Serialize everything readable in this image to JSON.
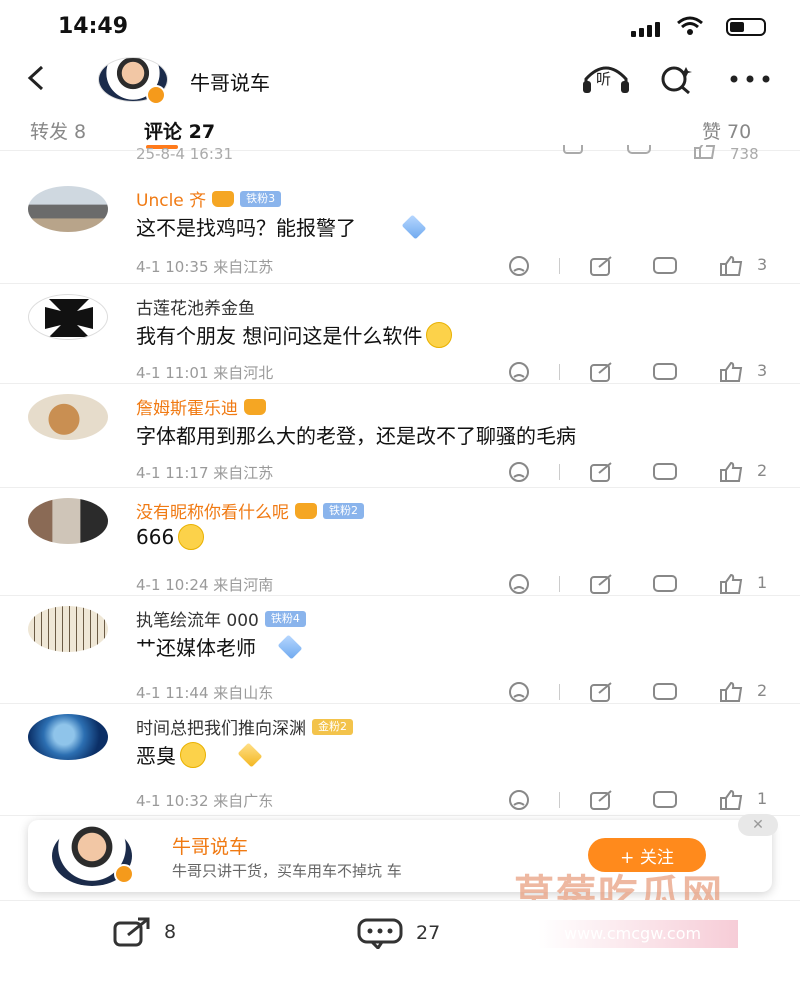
{
  "status_bar": {
    "time": "14:49"
  },
  "header": {
    "title": "牛哥说车",
    "listen_label": "听"
  },
  "tabs": {
    "repost": "转发 8",
    "comments": "评论 27",
    "likes": "赞 70"
  },
  "previous_row": {
    "meta": "25-8-4 16:31",
    "likes": "738"
  },
  "comments": [
    {
      "name": "Uncle 齐",
      "badge": "铁粉3",
      "text": "这不是找鸡吗？能报警了",
      "meta": "4-1 10:35  来自江苏",
      "likes": "3"
    },
    {
      "name": "古莲花池养金鱼",
      "badge": "",
      "text": "我有个朋友  想问问这是什么软件",
      "meta": "4-1 11:01  来自河北",
      "likes": "3"
    },
    {
      "name": "詹姆斯霍乐迪",
      "badge": "",
      "text": "字体都用到那么大的老登，还是改不了聊骚的毛病",
      "meta": "4-1 11:17  来自江苏",
      "likes": "2"
    },
    {
      "name": "没有昵称你看什么呢",
      "badge": "铁粉2",
      "text": "666",
      "meta": "4-1 10:24  来自河南",
      "likes": "1"
    },
    {
      "name": "执笔绘流年 000",
      "badge": "铁粉4",
      "text": "艹还媒体老师",
      "meta": "4-1 11:44  来自山东",
      "likes": "2"
    },
    {
      "name": "时间总把我们推向深渊",
      "badge": "金粉2",
      "text": "恶臭",
      "meta": "4-1 10:32  来自广东",
      "likes": "1"
    }
  ],
  "follow_banner": {
    "name": "牛哥说车",
    "subtitle": "牛哥只讲干货，买车用车不掉坑 车",
    "follow_label": "+ 关注",
    "close_label": "✕"
  },
  "bottom_bar": {
    "repost_count": "8",
    "comment_count": "27"
  },
  "watermark": {
    "name": "草莓吃瓜网",
    "url": "www.cmcgw.com"
  },
  "colors": {
    "accent": "#ff7a1a",
    "name_orange": "#f07a13",
    "iron_fan": "#8ab4ec",
    "gold_fan": "#f3c34b"
  }
}
